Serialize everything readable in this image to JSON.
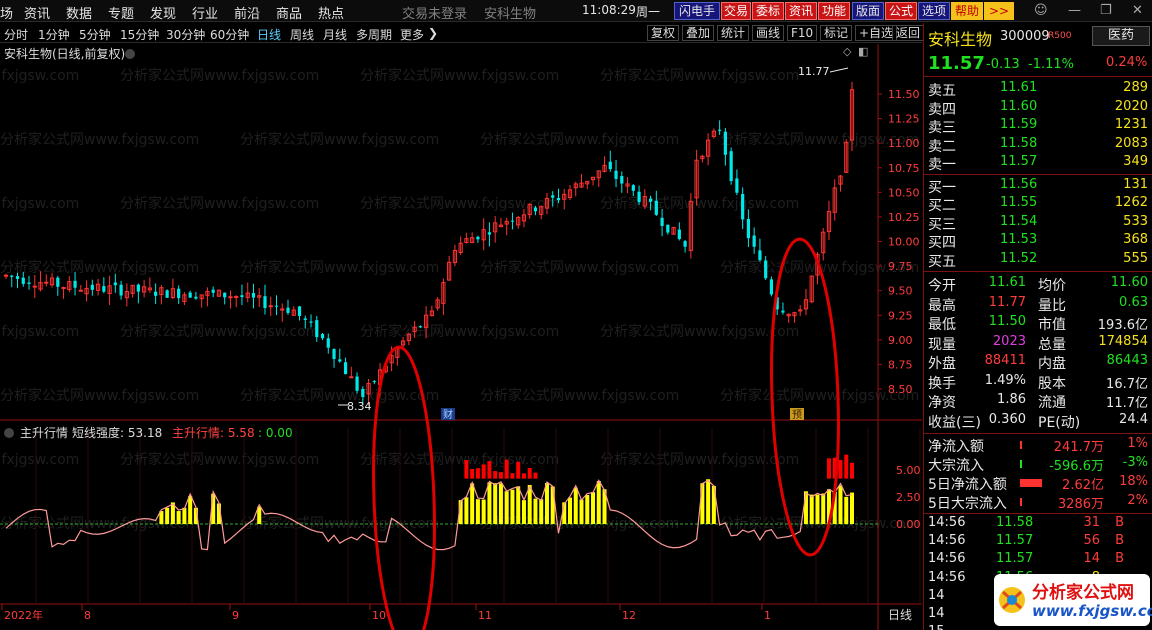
{
  "menu": {
    "items": [
      "场",
      "资讯",
      "数据",
      "专题",
      "发现",
      "行业",
      "前沿",
      "商品",
      "热点"
    ],
    "title": "交易未登录",
    "stock_title": "安科生物",
    "time": "11:08:29",
    "weekday": "周一",
    "toolbar": [
      "闪电手",
      "交易",
      "委标",
      "资讯",
      "功能",
      "版面",
      "公式",
      "选项",
      "帮助"
    ],
    "more": ">>"
  },
  "tabs": {
    "periods": [
      "分时",
      "1分钟",
      "5分钟",
      "15分钟",
      "30分钟",
      "60分钟",
      "日线",
      "周线",
      "月线",
      "多周期",
      "更多"
    ],
    "active": "日线",
    "more_arrow": "❯",
    "right_buttons": [
      "复权",
      "叠加",
      "统计",
      "画线",
      "F10",
      "标记",
      "+自选",
      "返回"
    ]
  },
  "chart": {
    "title": "安科生物(日线,前复权)",
    "high_label": "11.77",
    "low_label": "8.34",
    "badge_cai": "财",
    "badge_yu": "预",
    "price_ticks": [
      "11.50",
      "11.25",
      "11.00",
      "10.75",
      "10.50",
      "10.25",
      "10.00",
      "9.75",
      "9.50",
      "9.25",
      "9.00",
      "8.75",
      "8.50"
    ],
    "indicator_title": "主升行情",
    "indicator_strength_label": "短线强度: 53.18",
    "indicator_value_label": "主升行情: 5.58",
    "indicator_zero_label": ": 0.00",
    "indicator_ticks": [
      "5.00",
      "2.50",
      "0.00"
    ],
    "date_labels": [
      "2022年",
      "8",
      "9",
      "10",
      "11",
      "12",
      "1"
    ],
    "period_label": "日线",
    "watermark": "分析家公式网www.fxjgsw.com",
    "colors": {
      "up": "#ff3232",
      "down": "#00e8e8",
      "yellow": "#ffff00",
      "red_bar": "#ff0000",
      "line": "#ff9a9a",
      "axis": "#9a1010"
    }
  },
  "quote": {
    "name": "安科生物",
    "code": "300009",
    "tag": "R500",
    "sector_btn": "医药",
    "sector_change": "0.24%",
    "price": "11.57",
    "change": "-0.13",
    "change_pct": "-1.11%",
    "asks": [
      {
        "label": "卖五",
        "price": "11.61",
        "vol": "289"
      },
      {
        "label": "卖四",
        "price": "11.60",
        "vol": "2020"
      },
      {
        "label": "卖三",
        "price": "11.59",
        "vol": "1231"
      },
      {
        "label": "卖二",
        "price": "11.58",
        "vol": "2083"
      },
      {
        "label": "卖一",
        "price": "11.57",
        "vol": "349"
      }
    ],
    "bids": [
      {
        "label": "买一",
        "price": "11.56",
        "vol": "131"
      },
      {
        "label": "买二",
        "price": "11.55",
        "vol": "1262"
      },
      {
        "label": "买三",
        "price": "11.54",
        "vol": "533"
      },
      {
        "label": "买四",
        "price": "11.53",
        "vol": "368"
      },
      {
        "label": "买五",
        "price": "11.52",
        "vol": "555"
      }
    ],
    "stats": [
      {
        "l1": "今开",
        "v1": "11.61",
        "c1": "g",
        "l2": "均价",
        "v2": "11.60",
        "c2": "g"
      },
      {
        "l1": "最高",
        "v1": "11.77",
        "c1": "r",
        "l2": "量比",
        "v2": "0.63",
        "c2": "g"
      },
      {
        "l1": "最低",
        "v1": "11.50",
        "c1": "g",
        "l2": "市值",
        "v2": "193.6亿",
        "c2": "w"
      },
      {
        "l1": "现量",
        "v1": "2023",
        "c1": "mag",
        "l2": "总量",
        "v2": "174854",
        "c2": "y"
      },
      {
        "l1": "外盘",
        "v1": "88411",
        "c1": "r",
        "l2": "内盘",
        "v2": "86443",
        "c2": "g"
      },
      {
        "l1": "换手",
        "v1": "1.49%",
        "c1": "w",
        "l2": "股本",
        "v2": "16.7亿",
        "c2": "w"
      },
      {
        "l1": "净资",
        "v1": "1.86",
        "c1": "w",
        "l2": "流通",
        "v2": "11.7亿",
        "c2": "w"
      },
      {
        "l1": "收益(三)",
        "v1": "0.360",
        "c1": "w",
        "l2": "PE(动)",
        "v2": "24.4",
        "c2": "w"
      }
    ],
    "flows": [
      {
        "label": "净流入额",
        "value": "241.7万",
        "pct": "1%",
        "c": "r"
      },
      {
        "label": "大宗流入",
        "value": "-596.6万",
        "pct": "-3%",
        "c": "g"
      },
      {
        "label": "5日净流入额",
        "value": "2.62亿",
        "pct": "18%",
        "c": "r"
      },
      {
        "label": "5日大宗流入",
        "value": "3286万",
        "pct": "2%",
        "c": "r"
      }
    ],
    "ticks": [
      {
        "time": "14:56",
        "price": "11.58",
        "vol": "31",
        "dir": "B",
        "c": "r"
      },
      {
        "time": "14:56",
        "price": "11.57",
        "vol": "56",
        "dir": "B",
        "c": "r"
      },
      {
        "time": "14:56",
        "price": "11.57",
        "vol": "14",
        "dir": "B",
        "c": "r"
      },
      {
        "time": "14:56",
        "price": "11.56",
        "vol": "8",
        "dir": "",
        "c": "y"
      },
      {
        "time": "14",
        "price": "",
        "vol": "",
        "dir": "",
        "c": "w"
      },
      {
        "time": "14",
        "price": "",
        "vol": "",
        "dir": "",
        "c": "w"
      },
      {
        "time": "15",
        "price": "",
        "vol": "",
        "dir": "",
        "c": "w"
      }
    ]
  },
  "brand": {
    "name": "分析家公式网",
    "url": "www.fxjgsw.com"
  }
}
